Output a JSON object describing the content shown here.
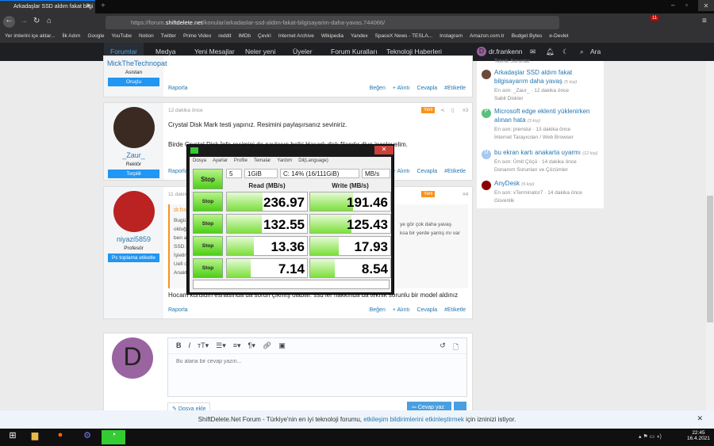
{
  "browser": {
    "tab_title": "Arkadaşlar SSD aldım fakat bilgi",
    "url_prefix": "https://forum.",
    "url_domain": "shiftdelete.net",
    "url_path": "/konular/arkadaslar-ssd-aldim-fakat-bilgisayarim-daha-yavas.744066/",
    "badge": "11",
    "bookmarks": [
      "Yer imlerini içe aktar...",
      "İlk Adım",
      "Google",
      "YouTube",
      "Notion",
      "Twitter",
      "Prime Video",
      "reddit",
      "IMDb",
      "Çeviri",
      "Internet Archive",
      "Wikipedia",
      "Yandex",
      "SpaceX News - TESLA...",
      "Instagram",
      "Amazon.com.tr",
      "Budget Bytes",
      "e-Devlet"
    ]
  },
  "nav": {
    "items": [
      "Forumlar",
      "Medya",
      "Yeni Mesajlar",
      "Neler yeni",
      "Üyeler",
      "Forum Kuralları",
      "Teknoloji Haberleri"
    ],
    "user": "dr.frankenn",
    "user_initial": "D",
    "search": "Ara"
  },
  "actions": {
    "report": "Raporla",
    "like": "Beğen",
    "quote": "+ Alıntı",
    "reply": "Cevapla",
    "tag": "#Etiketle"
  },
  "posts": [
    {
      "user": "MickTheTechnopat",
      "role": "Asistan",
      "banner": "Oruçlu"
    },
    {
      "user": "_Zaur_",
      "role": "Rektör",
      "banner": "Torpilli",
      "time": "12 dakika önce",
      "badge": "Yeni",
      "num": "#3",
      "text1": "Crystal Disk Mark testi yapınız. Resimini paylaşırsanız seviniriz.",
      "text2": "Birde Crystal Disk İnfo resimini de paylaşın belki Hasarlı disk filandır diye inceleyelim."
    },
    {
      "user": "niyazi5859",
      "role": "Profesör",
      "banner": "Pc toplama etiketle",
      "time": "11 dakika önce",
      "badge": "Yeni",
      "num": "#4",
      "quote_author": "dr.fra",
      "quote_lines": [
        "Bugü",
        "olduğ",
        "ben a",
        "SSD:",
        "İşletin",
        "Uefi o",
        "Anakt"
      ],
      "quote_right1": "ye gör çok daha yavaş",
      "quote_right2": "ksa bir yerde yanlış mı var",
      "text": "Hocam kurulum esnasında da sorun çıkmış olabilir. ssd ler hakkında da teknik sorunlu bir model aldınız"
    }
  ],
  "sidebar": {
    "top_cat": "Teknik Sorunlar",
    "items": [
      {
        "title": "Arkadaşlar SSD aldım fakat bilgisayarım daha yavaş",
        "count": "(5 kişi)",
        "last": "En son: _Zaur_ · 12 dakika önce",
        "cat": "Sabit Diskler",
        "initial": ""
      },
      {
        "title": "Microsoft edge eklenti yüklenirken alınan hata",
        "count": "(3 kişi)",
        "last": "En son: prenslui · 13 dakika önce",
        "cat": "İnternet Tarayıcıları / Web Browser",
        "initial": "P"
      },
      {
        "title": "bu ekran kartı anakarta uyarmı",
        "count": "(12 kişi)",
        "last": "En son: Ümit Çöçü · 14 dakika önce",
        "cat": "Donanım Sorunları ve Çözümler",
        "initial": "Ü"
      },
      {
        "title": "AnyDesk",
        "count": "(9 kişi)",
        "last": "En son: xTerminator7 · 14 dakika önce",
        "cat": "Güvenlik",
        "initial": ""
      }
    ]
  },
  "cdm": {
    "menu": [
      "Dosya",
      "Ayarlar",
      "Profile",
      "Temalar",
      "Yardım",
      "Dil(Language)"
    ],
    "main_button": "Stop",
    "count": "5",
    "size": "1GiB",
    "drive": "C: 14% (16/111GiB)",
    "unit": "MB/s",
    "read_header": "Read (MB/s)",
    "write_header": "Write (MB/s)",
    "rows": [
      {
        "label": "Stop",
        "read": "236.97",
        "write": "191.46",
        "read_pct": 45,
        "write_pct": 53
      },
      {
        "label": "Stop",
        "read": "132.55",
        "write": "125.43",
        "read_pct": 44,
        "write_pct": 51
      },
      {
        "label": "Stop",
        "read": "13.36",
        "write": "17.93",
        "read_pct": 34,
        "write_pct": 36
      },
      {
        "label": "Stop",
        "read": "7.14",
        "write": "8.54",
        "read_pct": 30,
        "write_pct": 31
      }
    ]
  },
  "editor": {
    "placeholder": "Bu alana bir cevap yazın...",
    "attach": "Dosya ekle",
    "submit": "Cevap yaz"
  },
  "notification": {
    "pre": "ShiftDelete.Net Forum - Türkiye'nin en iyi teknoloji forumu, ",
    "link": "etkileşim bildirimlerini etkinleştirmek",
    "post": " için izninizi istiyor."
  },
  "taskbar": {
    "time": "22:45",
    "date": "16.4.2021"
  }
}
